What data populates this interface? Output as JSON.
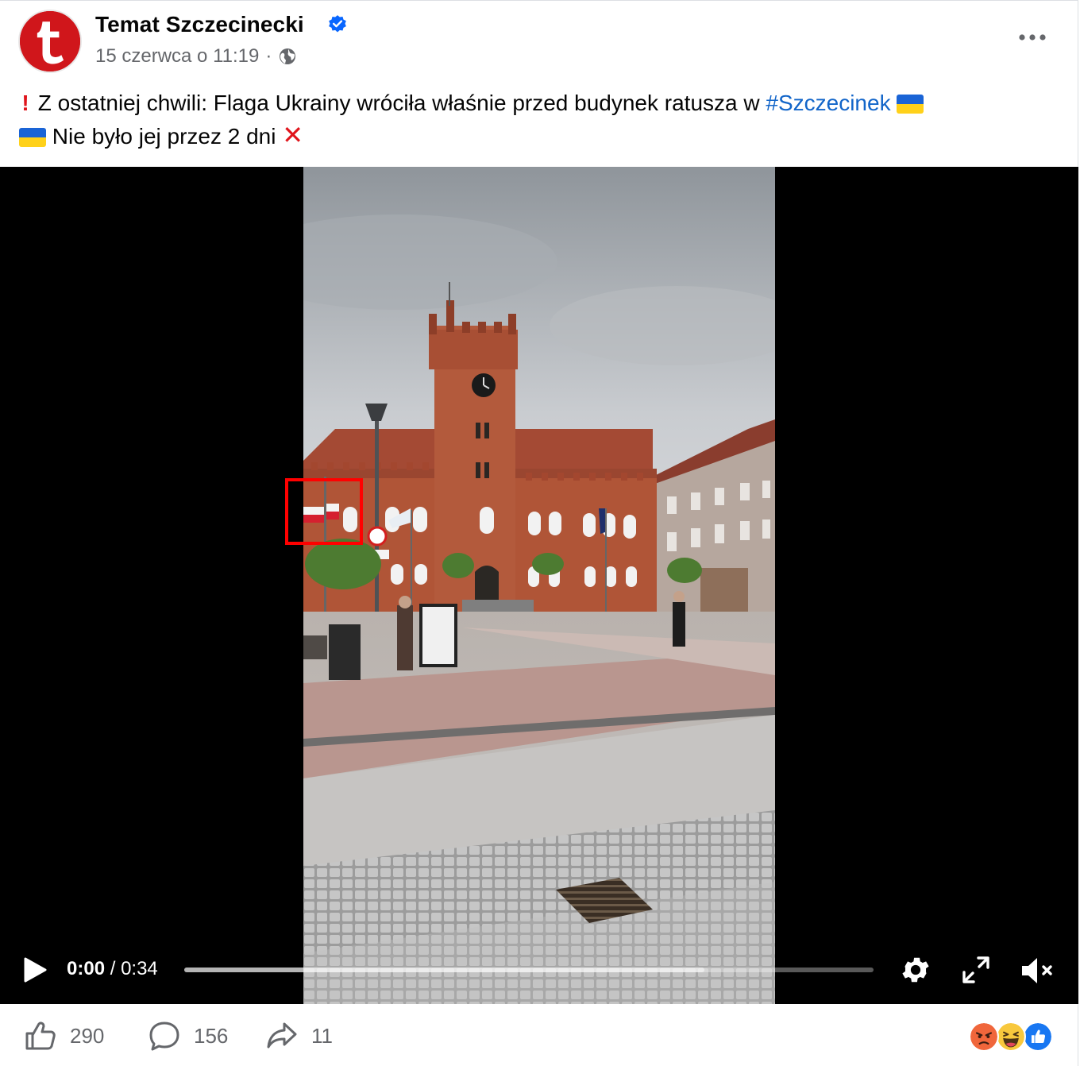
{
  "post": {
    "page_name": "Temat Szczecinecki",
    "timestamp": "15 czerwca o 11:19",
    "separator": "·",
    "avatar_letter": "t",
    "caption": {
      "part1": "Z ostatniej chwili: Flaga Ukrainy wróciła właśnie przed budynek ratusza w ",
      "hashtag": "#Szczecinek",
      "part2": " Nie było jej przez 2 dni "
    }
  },
  "video": {
    "current_time": "0:00",
    "time_separator": "/",
    "duration": "0:34",
    "buffered_fraction": 0.755
  },
  "footer": {
    "like_count": "290",
    "comment_count": "156",
    "share_count": "11"
  },
  "icons": {
    "verified": "verified-badge-icon",
    "audience": "globe-icon",
    "more": "more-options-icon",
    "play": "play-icon",
    "settings": "gear-icon",
    "fullscreen": "expand-icon",
    "mute": "speaker-muted-icon",
    "like": "thumbs-up-icon",
    "comment": "comment-bubble-icon",
    "share": "share-arrow-icon"
  },
  "colors": {
    "hashtag": "#1265c9",
    "verified": "#0866ff",
    "highlight_box": "#ff0000",
    "avatar_bg": "#d0161b",
    "muted_text": "#65676b"
  }
}
